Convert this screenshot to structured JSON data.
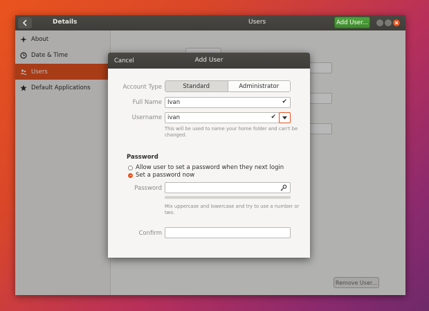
{
  "window": {
    "back_icon": "chevron-left-icon",
    "sidebar_title": "Details",
    "title": "Users",
    "add_user_label": "Add User...",
    "controls": [
      "minimize-icon",
      "maximize-icon",
      "close-icon"
    ]
  },
  "sidebar": {
    "items": [
      {
        "label": "About",
        "icon": "sparkle-icon",
        "active": false
      },
      {
        "label": "Date & Time",
        "icon": "clock-icon",
        "active": false
      },
      {
        "label": "Users",
        "icon": "users-icon",
        "active": true
      },
      {
        "label": "Default Applications",
        "icon": "star-icon",
        "active": false
      }
    ]
  },
  "main": {
    "remove_user_label": "Remove User..."
  },
  "dialog": {
    "title": "Add User",
    "cancel_label": "Cancel",
    "account_type": {
      "label": "Account Type",
      "options": [
        "Standard",
        "Administrator"
      ],
      "selected": "Standard"
    },
    "full_name": {
      "label": "Full Name",
      "value": "Ivan"
    },
    "username": {
      "label": "Username",
      "value": "ivan",
      "hint_line1": "This will be used to name your home folder and can't be",
      "hint_line2": "changed."
    },
    "password_section": {
      "title": "Password",
      "option_later": "Allow user to set a password when they next login",
      "option_now": "Set a password now",
      "selected": "now",
      "password_label": "Password",
      "password_value": "",
      "hint_line1": "Mix uppercase and lowercase and try to use a number or",
      "hint_line2": "two.",
      "strength": 0,
      "confirm_label": "Confirm",
      "confirm_value": ""
    }
  },
  "colors": {
    "accent": "#e95420",
    "add_button": "#4fa33b",
    "headerbar": "#3f3d39"
  }
}
